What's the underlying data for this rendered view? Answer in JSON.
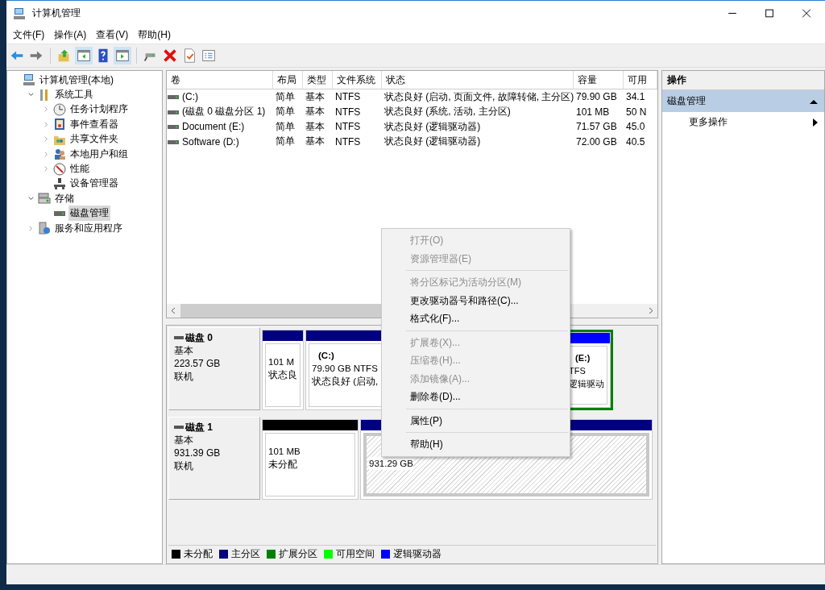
{
  "window": {
    "title": "计算机管理"
  },
  "menu": [
    "文件(F)",
    "操作(A)",
    "查看(V)",
    "帮助(H)"
  ],
  "toolbar": [
    {
      "kind": "back",
      "selected": false
    },
    {
      "kind": "forward",
      "selected": false
    },
    {
      "kind": "up",
      "selected": false
    },
    {
      "kind": "tree",
      "selected": true
    },
    {
      "kind": "help",
      "selected": false
    },
    {
      "kind": "pane",
      "selected": true
    },
    {
      "kind": "connect",
      "selected": false
    },
    {
      "kind": "delete",
      "selected": false
    },
    {
      "kind": "check",
      "selected": false
    },
    {
      "kind": "list",
      "selected": false
    }
  ],
  "tree": [
    {
      "label": "计算机管理(本地)",
      "kind": "computer",
      "selected": false,
      "children": [
        {
          "label": "系统工具",
          "kind": "tools",
          "expanded": true,
          "selected": false,
          "children": [
            {
              "label": "任务计划程序",
              "kind": "clock",
              "expanded": false,
              "selected": false
            },
            {
              "label": "事件查看器",
              "kind": "event",
              "expanded": false,
              "selected": false
            },
            {
              "label": "共享文件夹",
              "kind": "share",
              "expanded": false,
              "selected": false
            },
            {
              "label": "本地用户和组",
              "kind": "users",
              "expanded": false,
              "selected": false
            },
            {
              "label": "性能",
              "kind": "perf",
              "expanded": false,
              "selected": false
            },
            {
              "label": "设备管理器",
              "kind": "device",
              "selected": false
            }
          ]
        },
        {
          "label": "存储",
          "kind": "storage",
          "expanded": true,
          "selected": false,
          "children": [
            {
              "label": "磁盘管理",
              "kind": "disk",
              "selected": true
            }
          ]
        },
        {
          "label": "服务和应用程序",
          "kind": "services",
          "expanded": false,
          "selected": false
        }
      ]
    }
  ],
  "table": {
    "columns": [
      "卷",
      "布局",
      "类型",
      "文件系统",
      "状态",
      "容量",
      "可用"
    ],
    "rows": [
      [
        "(C:)",
        "简单",
        "基本",
        "NTFS",
        "状态良好 (启动, 页面文件, 故障转储, 主分区)",
        "79.90 GB",
        "34.1"
      ],
      [
        "(磁盘 0 磁盘分区 1)",
        "简单",
        "基本",
        "NTFS",
        "状态良好 (系统, 活动, 主分区)",
        "101 MB",
        "50 N"
      ],
      [
        "Document (E:)",
        "简单",
        "基本",
        "NTFS",
        "状态良好 (逻辑驱动器)",
        "71.57 GB",
        "45.0"
      ],
      [
        "Software (D:)",
        "简单",
        "基本",
        "NTFS",
        "状态良好 (逻辑驱动器)",
        "72.00 GB",
        "40.5"
      ]
    ]
  },
  "disks": [
    {
      "name": "磁盘 0",
      "type": "基本",
      "size": "223.57 GB",
      "status": "联机",
      "partitions": [
        {
          "kind": "primary",
          "lines": [
            "101 M",
            "状态良"
          ]
        },
        {
          "kind": "primary",
          "title": "(C:)",
          "lines": [
            "79.90 GB NTFS",
            "状态良好 (启动,"
          ]
        },
        {
          "kind": "extended",
          "title": "(E:)",
          "lines": [
            "TFS",
            "逻辑驱动"
          ]
        }
      ]
    },
    {
      "name": "磁盘 1",
      "type": "基本",
      "size": "931.39 GB",
      "status": "联机",
      "partitions": [
        {
          "kind": "unallocated",
          "lines": [
            "101 MB",
            "未分配"
          ]
        },
        {
          "kind": "free",
          "lines": [
            "931.29 GB"
          ]
        }
      ]
    }
  ],
  "legend": [
    {
      "label": "未分配",
      "color": "#000000"
    },
    {
      "label": "主分区",
      "color": "#000080"
    },
    {
      "label": "扩展分区",
      "color": "#008000"
    },
    {
      "label": "可用空间",
      "color": "#00ff00"
    },
    {
      "label": "逻辑驱动器",
      "color": "#0000ff"
    }
  ],
  "actions": {
    "title": "操作",
    "section": {
      "label": "磁盘管理",
      "expanded": true
    },
    "items": [
      "更多操作"
    ]
  },
  "context_menu": [
    [
      {
        "label": "打开(O)",
        "disabled": true
      },
      {
        "label": "资源管理器(E)",
        "disabled": true
      }
    ],
    [
      {
        "label": "将分区标记为活动分区(M)",
        "disabled": true
      },
      {
        "label": "更改驱动器号和路径(C)...",
        "disabled": false
      },
      {
        "label": "格式化(F)...",
        "disabled": false
      }
    ],
    [
      {
        "label": "扩展卷(X)...",
        "disabled": true
      },
      {
        "label": "压缩卷(H)...",
        "disabled": true
      },
      {
        "label": "添加镜像(A)...",
        "disabled": true
      },
      {
        "label": "删除卷(D)...",
        "disabled": false
      }
    ],
    [
      {
        "label": "属性(P)",
        "disabled": false
      }
    ],
    [
      {
        "label": "帮助(H)",
        "disabled": false
      }
    ]
  ]
}
